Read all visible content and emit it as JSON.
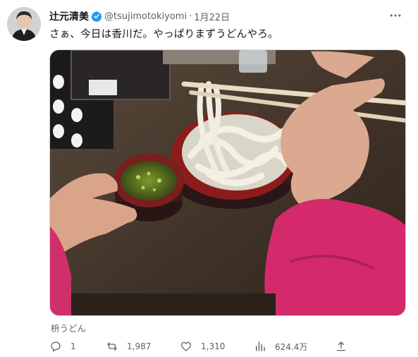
{
  "author": {
    "name": "辻元清美",
    "handle": "@tsujimotokiyomi",
    "separator": "·",
    "date": "1月22日",
    "avatar_icon": "avatar-photo",
    "verified_icon": "verified-badge-icon"
  },
  "post": {
    "text": "さぁ、今日は香川だ。やっぱりまずうどんやろ。",
    "image_alt": "photo-udon-noodles",
    "caption": "枡うどん"
  },
  "actions": {
    "reply_count": "1",
    "repost_count": "1,987",
    "like_count": "1,310",
    "view_count": "624.4万"
  },
  "colors": {
    "text_primary": "#0f1419",
    "text_secondary": "#536471",
    "verified_blue": "#1d9bf0",
    "border": "#cfd9de"
  }
}
